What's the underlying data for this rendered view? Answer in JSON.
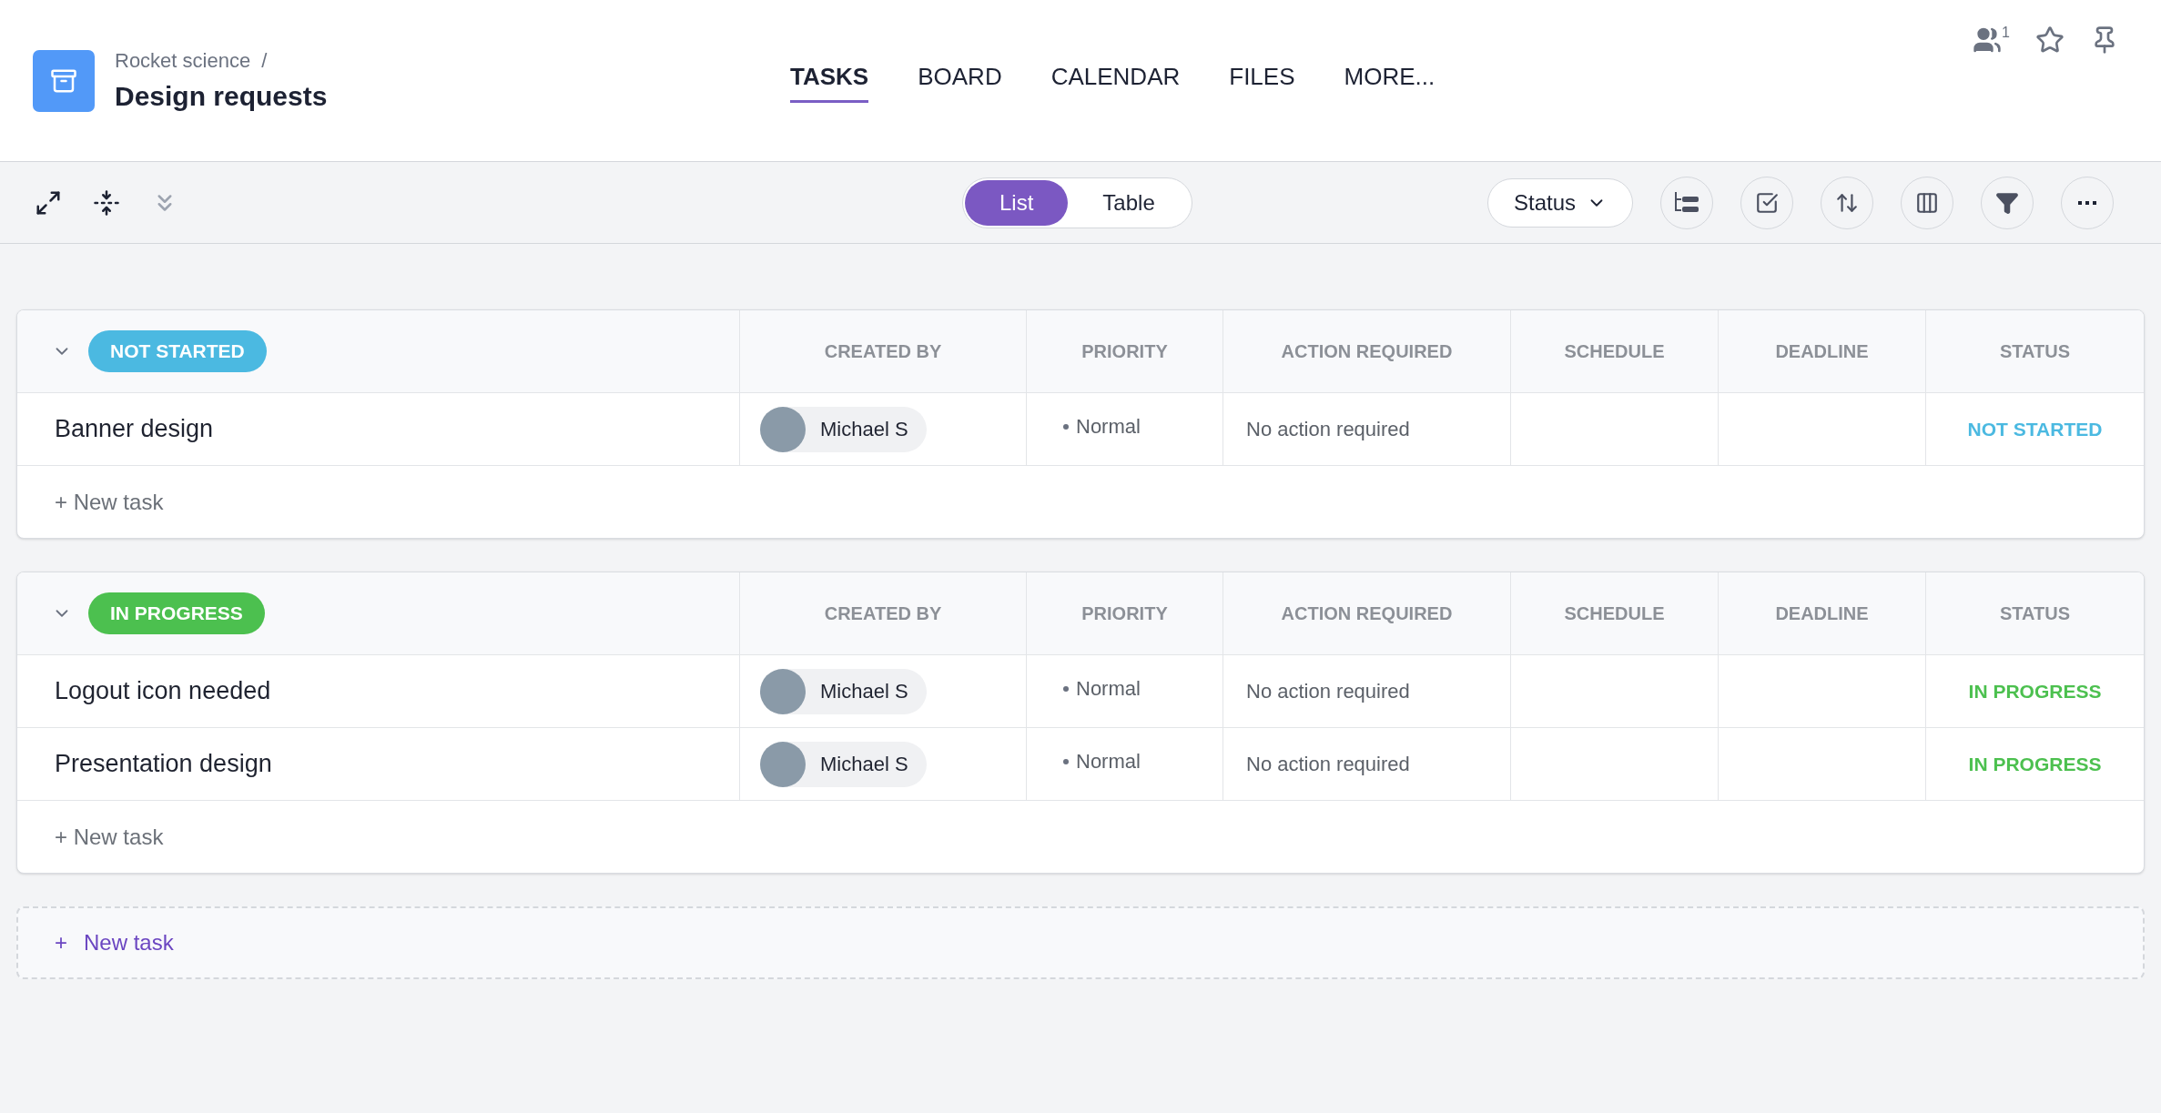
{
  "project": {
    "breadcrumb": "Rocket science",
    "separator": "/",
    "title": "Design requests"
  },
  "nav_tabs": [
    {
      "label": "TASKS",
      "selected": true
    },
    {
      "label": "BOARD",
      "selected": false
    },
    {
      "label": "CALENDAR",
      "selected": false
    },
    {
      "label": "FILES",
      "selected": false
    },
    {
      "label": "MORE...",
      "selected": false
    }
  ],
  "members_count": "1",
  "view_toggle": [
    {
      "label": "List",
      "selected": true
    },
    {
      "label": "Table",
      "selected": false
    }
  ],
  "group_by": "Status",
  "groups": [
    {
      "label": "NOT STARTED",
      "color": "#4bb9e1",
      "expanded": true,
      "columns": [
        "CREATED BY",
        "PRIORITY",
        "ACTION REQUIRED",
        "SCHEDULE",
        "DEADLINE",
        "STATUS"
      ],
      "tasks": [
        {
          "name": "Banner design",
          "created_by": "Michael S",
          "priority": "Normal",
          "action_required": "No action required",
          "status": "NOT STARTED"
        }
      ],
      "new_task": "+ New task"
    },
    {
      "label": "IN PROGRESS",
      "color": "#4cc04f",
      "expanded": true,
      "columns": [
        "CREATED BY",
        "PRIORITY",
        "ACTION REQUIRED",
        "SCHEDULE",
        "DEADLINE",
        "STATUS"
      ],
      "tasks": [
        {
          "name": "Logout icon needed",
          "created_by": "Michael S",
          "priority": "Normal",
          "action_required": "No action required",
          "status": "IN PROGRESS"
        },
        {
          "name": "Presentation design",
          "created_by": "Michael S",
          "priority": "Normal",
          "action_required": "No action required",
          "status": "IN PROGRESS"
        }
      ],
      "new_task": "+ New task"
    }
  ],
  "add_task": {
    "plus": "+",
    "label": "New task"
  }
}
